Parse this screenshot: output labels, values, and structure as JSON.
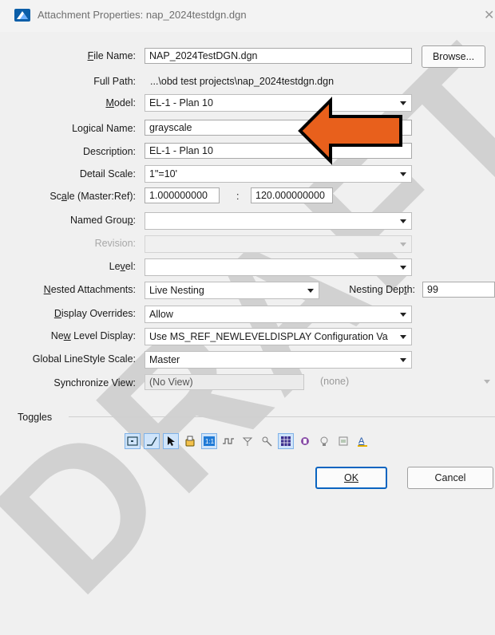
{
  "window": {
    "title": "Attachment Properties: nap_2024testdgn.dgn",
    "close_glyph": "✕"
  },
  "labels": {
    "file_name": "File Name:",
    "full_path": "Full Path:",
    "model": "Model:",
    "logical_name": "Logical Name:",
    "description": "Description:",
    "detail_scale": "Detail Scale:",
    "scale": "Scale (Master:Ref):",
    "named_group": "Named Group:",
    "revision": "Revision:",
    "level": "Level:",
    "nested_attachments": "Nested Attachments:",
    "nesting_depth": "Nesting Depth:",
    "display_overrides": "Display Overrides:",
    "new_level_display": "New Level Display:",
    "global_linestyle_scale": "Global LineStyle Scale:",
    "synchronize_view": "Synchronize View:",
    "toggles": "Toggles"
  },
  "values": {
    "file_name": "NAP_2024TestDGN.dgn",
    "full_path": "...\\obd test projects\\nap_2024testdgn.dgn",
    "model": "EL-1 - Plan 10",
    "logical_name": "grayscale",
    "description": "EL-1 - Plan 10",
    "detail_scale": "1\"=10'",
    "scale_master": "1.000000000",
    "scale_sep": ":",
    "scale_ref": "120.000000000",
    "named_group": "",
    "revision": "",
    "level": "",
    "nested_attachments": "Live Nesting",
    "nesting_depth": "99",
    "display_overrides": "Allow",
    "new_level_display": "Use MS_REF_NEWLEVELDISPLAY Configuration Va",
    "global_linestyle_scale": "Master",
    "synchronize_view": "(No View)",
    "synchronize_view_2": "(none)"
  },
  "buttons": {
    "browse": "Browse...",
    "ok": "OK",
    "cancel": "Cancel"
  },
  "toolbar_icons": [
    "display-toggle-icon",
    "locate-icon",
    "snap-icon",
    "ignore-icon",
    "true-scale-icon",
    "scale-line-styles-icon",
    "treat-as-element-icon",
    "clip-icon",
    "raster-icon",
    "display-raster-icon",
    "lights-icon",
    "print-icon",
    "text-icon"
  ],
  "annotation_arrow_color": "#e8601c",
  "watermark": "DRAFT"
}
